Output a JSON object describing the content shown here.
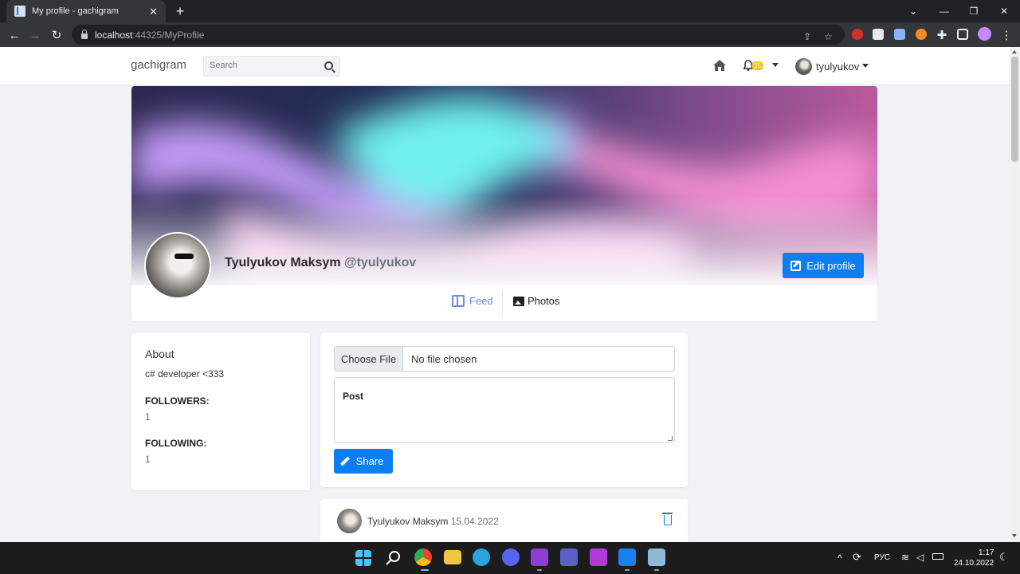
{
  "browser": {
    "tab_title": "My profile - gachigram",
    "tab_close": "✕",
    "new_tab": "+",
    "url_host": "localhost",
    "url_rest": ":44325/MyProfile",
    "window_controls": [
      "⌄",
      "—",
      "❐",
      "✕"
    ]
  },
  "site": {
    "brand": "gachigram",
    "search_placeholder": "Search",
    "notification_count": "35",
    "username": "tyulyukov"
  },
  "profile": {
    "full_name": "Tyulyukov Maksym",
    "handle": "@tyulyukov",
    "edit_label": "Edit profile",
    "tabs": [
      "Feed",
      "Photos"
    ]
  },
  "about": {
    "title": "About",
    "bio": "c# developer <333",
    "followers_label": "FOLLOWERS:",
    "followers_count": "1",
    "following_label": "FOLLOWING:",
    "following_count": "1"
  },
  "composer": {
    "choose_file": "Choose File",
    "no_file": "No file chosen",
    "post_placeholder": "Post",
    "share_label": "Share"
  },
  "posts": [
    {
      "author": "Tyulyukov Maksym",
      "date": "15.04.2022"
    }
  ],
  "taskbar": {
    "language": "РУС",
    "time": "1:17",
    "date": "24.10.2022"
  },
  "colors": {
    "primary": "#0d7ef2",
    "feed_active": "#6b8ce0",
    "badge": "#f7c21a"
  }
}
